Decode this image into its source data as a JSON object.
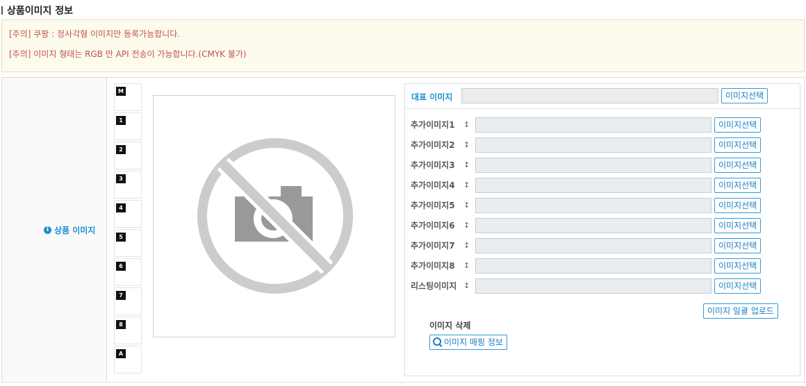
{
  "section": {
    "title": "상품이미지 정보"
  },
  "notices": [
    "[주의] 쿠팡 : 정사각형 이미지만 등록가능합니다.",
    "[주의] 이미지 형태는 RGB 만 API 전송이 가능합니다.(CMYK 불가)"
  ],
  "label": {
    "text": "상품 이미지",
    "icon": "info-icon"
  },
  "thumbs": [
    "M",
    "1",
    "2",
    "3",
    "4",
    "5",
    "6",
    "7",
    "8",
    "A"
  ],
  "preview": {
    "icon": "no-image-camera-icon"
  },
  "main_image": {
    "label": "대표 이미지",
    "value": "",
    "button": "이미지선택"
  },
  "sub_images": [
    {
      "label": "추가이미지1",
      "value": "",
      "button": "이미지선택"
    },
    {
      "label": "추가이미지2",
      "value": "",
      "button": "이미지선택"
    },
    {
      "label": "추가이미지3",
      "value": "",
      "button": "이미지선택"
    },
    {
      "label": "추가이미지4",
      "value": "",
      "button": "이미지선택"
    },
    {
      "label": "추가이미지5",
      "value": "",
      "button": "이미지선택"
    },
    {
      "label": "추가이미지6",
      "value": "",
      "button": "이미지선택"
    },
    {
      "label": "추가이미지7",
      "value": "",
      "button": "이미지선택"
    },
    {
      "label": "추가이미지8",
      "value": "",
      "button": "이미지선택"
    },
    {
      "label": "리스팅이미지",
      "value": "",
      "button": "이미지선택"
    }
  ],
  "sort_icon": "↕",
  "bulk_upload": "이미지 일괄 업로드",
  "delete_label": "이미지 삭제",
  "mapping_button": "이미지 매핑 정보",
  "colors": {
    "accent": "#1a8fcf",
    "notice_text": "#c0504d",
    "notice_bg": "#fdfbee"
  }
}
